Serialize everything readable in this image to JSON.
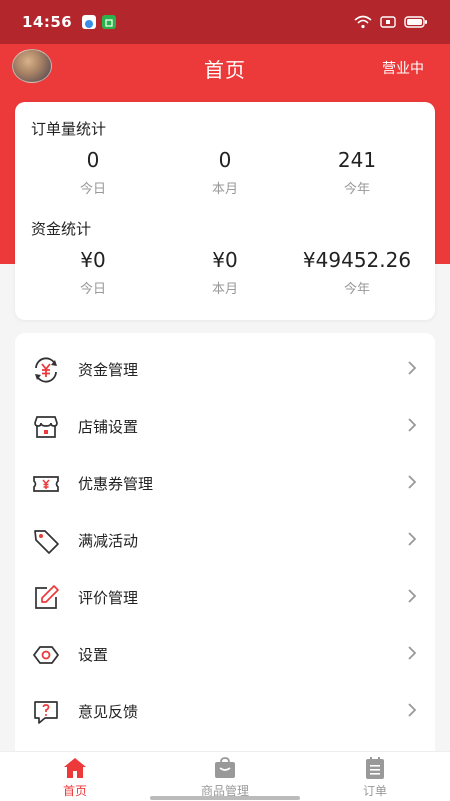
{
  "status_bar": {
    "time": "14:56"
  },
  "header": {
    "title": "首页",
    "status": "营业中"
  },
  "orders": {
    "title": "订单量统计",
    "stats": [
      {
        "value": "0",
        "label": "今日"
      },
      {
        "value": "0",
        "label": "本月"
      },
      {
        "value": "241",
        "label": "今年"
      }
    ]
  },
  "funds": {
    "title": "资金统计",
    "stats": [
      {
        "value": "¥0",
        "label": "今日"
      },
      {
        "value": "¥0",
        "label": "本月"
      },
      {
        "value": "¥49452.26",
        "label": "今年"
      }
    ]
  },
  "menu": [
    {
      "label": "资金管理",
      "icon": "yuan-exchange-icon"
    },
    {
      "label": "店铺设置",
      "icon": "store-icon"
    },
    {
      "label": "优惠券管理",
      "icon": "coupon-icon"
    },
    {
      "label": "满减活动",
      "icon": "tag-icon"
    },
    {
      "label": "评价管理",
      "icon": "edit-icon"
    },
    {
      "label": "设置",
      "icon": "settings-icon"
    },
    {
      "label": "意见反馈",
      "icon": "feedback-icon"
    }
  ],
  "tabs": [
    {
      "label": "首页",
      "icon": "home-icon",
      "active": true
    },
    {
      "label": "商品管理",
      "icon": "bag-icon",
      "active": false
    },
    {
      "label": "订单",
      "icon": "clipboard-icon",
      "active": false
    }
  ],
  "colors": {
    "primary": "#ec3a3a",
    "status_bar": "#b3262c",
    "icon_dark": "#333333",
    "inactive": "#999999"
  }
}
